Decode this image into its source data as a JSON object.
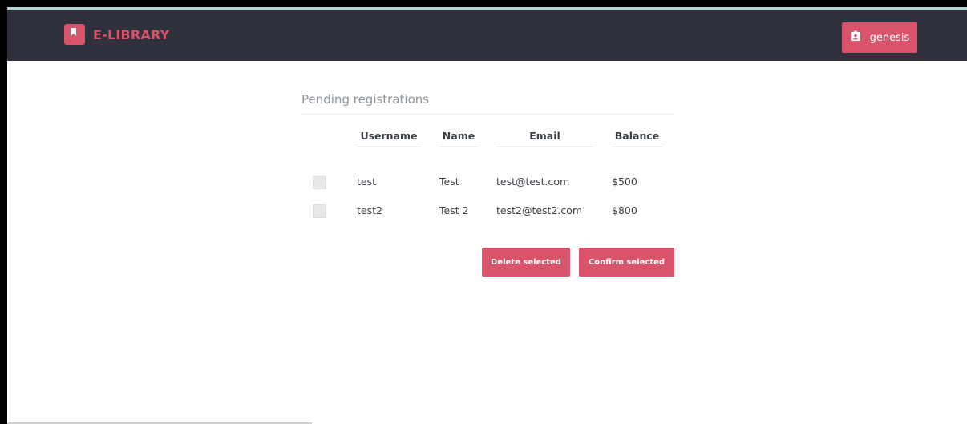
{
  "app": {
    "brand": "E-LIBRARY",
    "user_label": "genesis",
    "colors": {
      "navbar": "#2f323d",
      "accent": "#d9546b",
      "top_line": "#a9d9d3"
    },
    "icons": {
      "brand": "bookmark-icon",
      "user": "user-badge-icon"
    }
  },
  "page": {
    "section_title": "Pending registrations",
    "table": {
      "columns": [
        "Username",
        "Name",
        "Email",
        "Balance"
      ],
      "rows": [
        {
          "username": "test",
          "name": "Test",
          "email": "test@test.com",
          "balance": "$500",
          "checked": false
        },
        {
          "username": "test2",
          "name": "Test 2",
          "email": "test2@test2.com",
          "balance": "$800",
          "checked": false
        }
      ]
    },
    "actions": {
      "delete_label": "Delete selected",
      "confirm_label": "Confirm selected"
    }
  }
}
